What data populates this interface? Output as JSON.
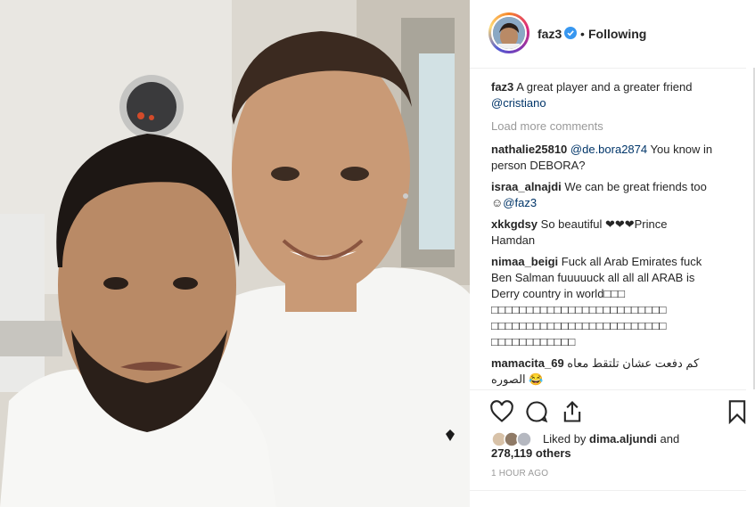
{
  "header": {
    "username": "faz3",
    "following_label": "Following",
    "separator": "•"
  },
  "caption": {
    "username": "faz3",
    "text": "A great player and a greater friend",
    "mention": "@cristiano"
  },
  "load_more_label": "Load more comments",
  "comments": [
    {
      "username": "nathalie25810",
      "mention": "@de.bora2874",
      "text": "You know in person DEBORA?"
    },
    {
      "username": "israa_alnajdi",
      "text": "We can be great friends too ☺",
      "mention": "@faz3"
    },
    {
      "username": "xkkgdsy",
      "text": "So beautiful ❤❤❤Prince Hamdan"
    },
    {
      "username": "nimaa_beigi",
      "text": "Fuck all Arab Emirates fuck Ben Salman fuuuuuck all all all ARAB is Derry country in world□□□ □□□□□□□□□□□□□□□□□□□□□□□□□ □□□□□□□□□□□□□□□□□□□□□□□□□ □□□□□□□□□□□□"
    },
    {
      "username": "mamacita_69",
      "text": "کم دفعت عشان تلتقط معاه الصوره 😂"
    }
  ],
  "likes": {
    "prefix": "Liked by",
    "user": "dima.aljundi",
    "conjunction": "and",
    "others": "278,119 others"
  },
  "timestamp": "1 HOUR AGO",
  "icons": {
    "like": "heart-icon",
    "comment": "comment-icon",
    "share": "share-icon",
    "save": "bookmark-icon",
    "verified": "verified-badge-icon"
  },
  "colors": {
    "verified": "#3897f0",
    "mention": "#003569",
    "muted": "#999999",
    "text": "#262626"
  }
}
